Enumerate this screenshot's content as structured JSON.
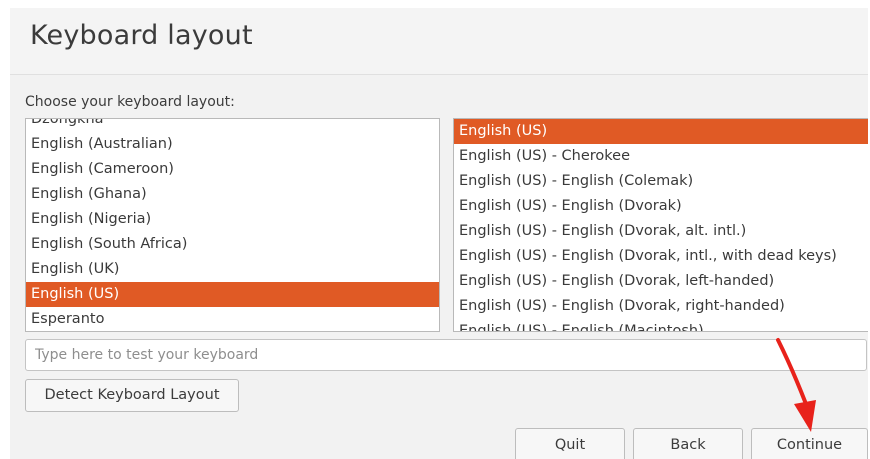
{
  "dialog": {
    "title": "Keyboard layout"
  },
  "prompt": "Choose your keyboard layout:",
  "layouts": {
    "items": [
      "Dzongkha",
      "English (Australian)",
      "English (Cameroon)",
      "English (Ghana)",
      "English (Nigeria)",
      "English (South Africa)",
      "English (UK)",
      "English (US)",
      "Esperanto"
    ],
    "selected": "English (US)"
  },
  "variants": {
    "items": [
      "English (US)",
      "English (US) - Cherokee",
      "English (US) - English (Colemak)",
      "English (US) - English (Dvorak)",
      "English (US) - English (Dvorak, alt. intl.)",
      "English (US) - English (Dvorak, intl., with dead keys)",
      "English (US) - English (Dvorak, left-handed)",
      "English (US) - English (Dvorak, right-handed)",
      "English (US) - English (Macintosh)"
    ],
    "selected": "English (US)"
  },
  "test_input": {
    "placeholder": "Type here to test your keyboard",
    "value": ""
  },
  "buttons": {
    "detect": "Detect Keyboard Layout",
    "quit": "Quit",
    "back": "Back",
    "continue": "Continue"
  },
  "colors": {
    "accent": "#e05a25",
    "annotation_arrow": "#e8221b"
  }
}
